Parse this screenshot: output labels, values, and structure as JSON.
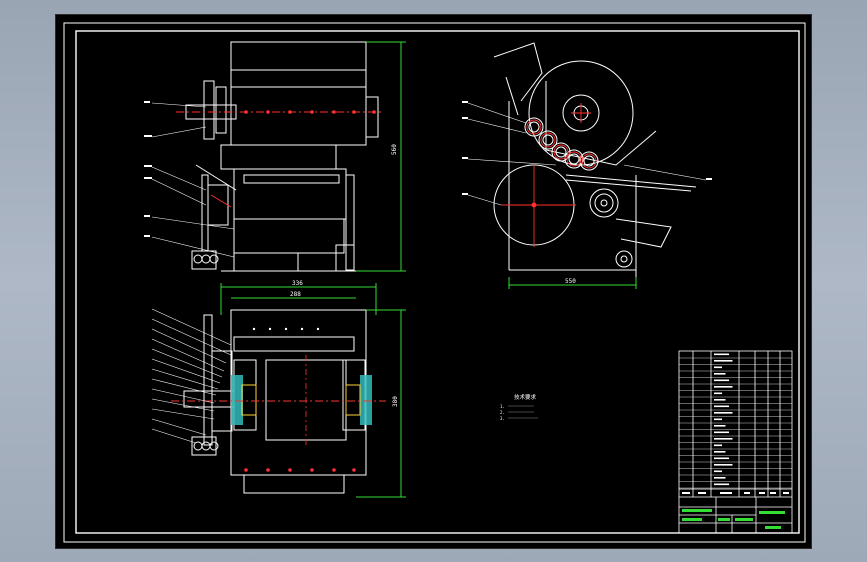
{
  "colors": {
    "background": "#000000",
    "outline": "#ffffff",
    "centerline": "#ff3030",
    "dimension": "#33dd33",
    "hatch": "#33bbbb"
  },
  "notes": {
    "title": "技术要求",
    "lines": [
      "1.",
      "2.",
      "3."
    ]
  },
  "dimensions": {
    "top_width": "336",
    "inner_width": "288",
    "front_height": "560",
    "plan_height": "380",
    "side_width": "550"
  },
  "title_block": {
    "drawing_name": "—"
  }
}
